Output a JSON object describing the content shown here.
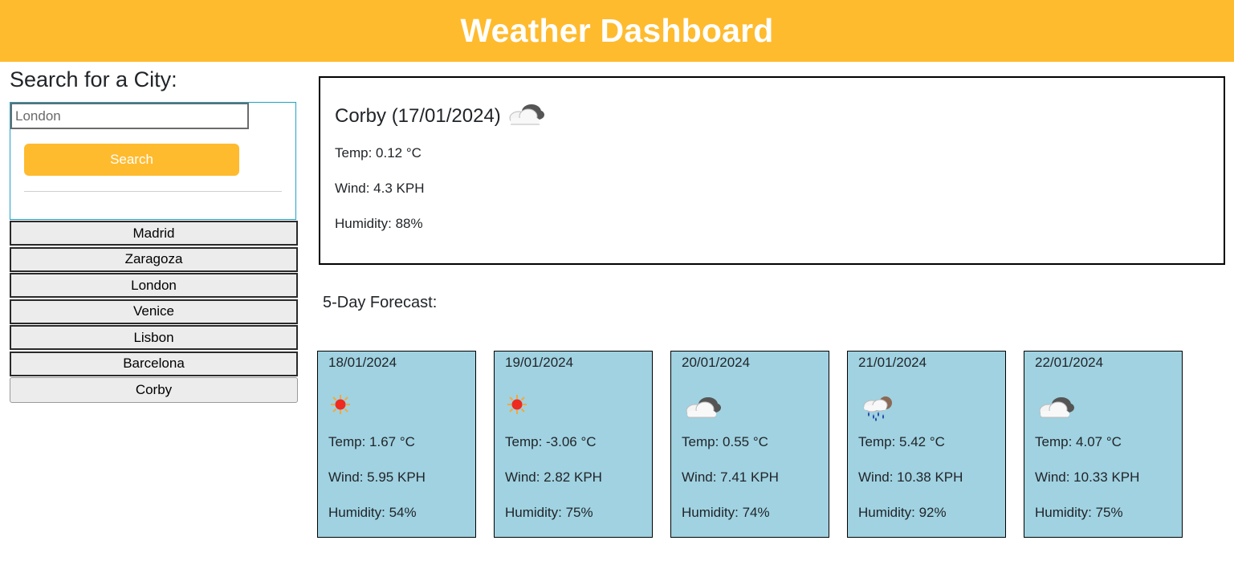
{
  "header": {
    "title": "Weather Dashboard"
  },
  "search": {
    "title": "Search for a City:",
    "placeholder": "London",
    "button_label": "Search"
  },
  "history": [
    "Madrid",
    "Zaragoza",
    "London",
    "Venice",
    "Lisbon",
    "Barcelona",
    "Corby"
  ],
  "current": {
    "title": "Corby (17/01/2024)",
    "icon": "partly-cloudy-icon",
    "temp": "Temp: 0.12 °C",
    "wind": "Wind: 4.3 KPH",
    "humidity": "Humidity: 88%"
  },
  "forecast": {
    "title": "5-Day Forecast:",
    "days": [
      {
        "date": "18/01/2024",
        "icon": "sun-icon",
        "temp": "Temp: 1.67 °C",
        "wind": "Wind: 5.95 KPH",
        "humidity": "Humidity: 54%"
      },
      {
        "date": "19/01/2024",
        "icon": "sun-icon",
        "temp": "Temp: -3.06 °C",
        "wind": "Wind: 2.82 KPH",
        "humidity": "Humidity: 75%"
      },
      {
        "date": "20/01/2024",
        "icon": "cloud-icon",
        "temp": "Temp: 0.55 °C",
        "wind": "Wind: 7.41 KPH",
        "humidity": "Humidity: 74%"
      },
      {
        "date": "21/01/2024",
        "icon": "rain-icon",
        "temp": "Temp: 5.42 °C",
        "wind": "Wind: 10.38 KPH",
        "humidity": "Humidity: 92%"
      },
      {
        "date": "22/01/2024",
        "icon": "cloud-icon",
        "temp": "Temp: 4.07 °C",
        "wind": "Wind: 10.33 KPH",
        "humidity": "Humidity: 75%"
      }
    ]
  },
  "colors": {
    "accent": "#ffbb2e",
    "card_bg": "#a0d2e1"
  }
}
